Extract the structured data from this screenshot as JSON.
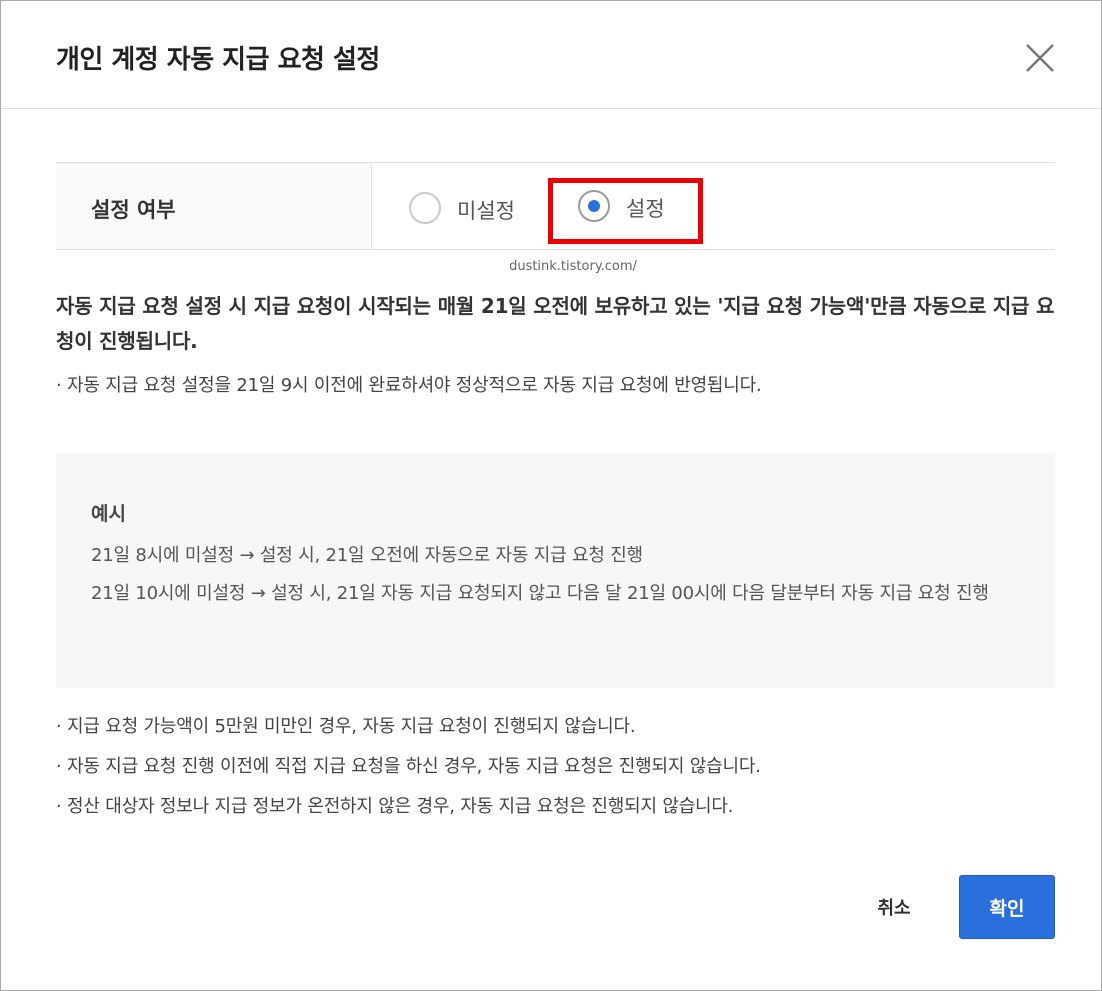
{
  "dialog": {
    "title": "개인 계정 자동 지급 요청 설정",
    "close_icon": "close-icon"
  },
  "setting": {
    "label": "설정 여부",
    "options": [
      {
        "label": "미설정",
        "selected": false
      },
      {
        "label": "설정",
        "selected": true
      }
    ]
  },
  "watermark": "dustink.tistory.com/",
  "notice": {
    "bold_text": "자동 지급 요청 설정 시 지급 요청이 시작되는 매월 21일 오전에 보유하고 있는 '지급 요청 가능액'만큼 자동으로 지급 요청이 진행됩니다.",
    "bullet": "· 자동 지급 요청 설정을 21일 9시 이전에 완료하셔야 정상적으로 자동 지급 요청에 반영됩니다."
  },
  "example": {
    "title": "예시",
    "lines": [
      "21일 8시에 미설정 → 설정 시, 21일 오전에 자동으로 자동 지급 요청 진행",
      "21일 10시에 미설정 → 설정 시, 21일 자동 지급 요청되지 않고 다음 달 21일 00시에 다음 달분부터 자동 지급 요청 진행"
    ]
  },
  "footnotes": [
    "· 지급 요청 가능액이 5만원 미만인 경우, 자동 지급 요청이 진행되지 않습니다.",
    "· 자동 지급 요청 진행 이전에 직접 지급 요청을 하신 경우, 자동 지급 요청은 진행되지 않습니다.",
    "· 정산 대상자 정보나 지급 정보가 온전하지 않은 경우, 자동 지급 요청은 진행되지 않습니다."
  ],
  "buttons": {
    "cancel": "취소",
    "confirm": "확인"
  },
  "colors": {
    "accent": "#2a6fdb",
    "highlight": "#ee0000"
  }
}
